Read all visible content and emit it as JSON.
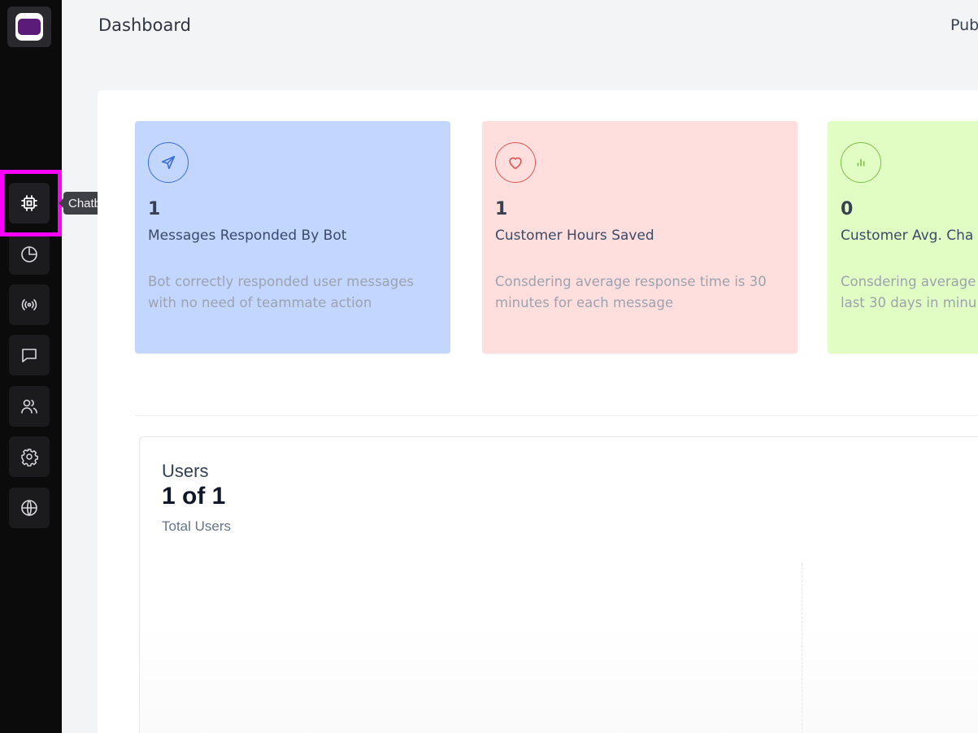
{
  "header": {
    "title": "Dashboard",
    "right_text": "Pub"
  },
  "sidebar": {
    "items": [
      {
        "icon": "chip-icon",
        "active": true
      },
      {
        "icon": "pie-chart-icon"
      },
      {
        "icon": "broadcast-icon"
      },
      {
        "icon": "message-icon"
      },
      {
        "icon": "users-icon"
      },
      {
        "icon": "gear-icon"
      },
      {
        "icon": "globe-icon"
      }
    ],
    "tooltip": "Chatbot AI",
    "highlight_color": "#ff00ff"
  },
  "cards": [
    {
      "icon": "send-icon",
      "value": "1",
      "title": "Messages Responded By Bot",
      "description": "Bot correctly responded user messages with no need of teammate action",
      "color": "#c2d6ff"
    },
    {
      "icon": "heart-icon",
      "value": "1",
      "title": "Customer Hours Saved",
      "description": "Consdering average response time is 30 minutes for each message",
      "color": "#ffdede"
    },
    {
      "icon": "bar-chart-icon",
      "value": "0",
      "title": "Customer Avg. Cha",
      "description_line1": "Consdering average",
      "description_line2": "last 30 days in minu",
      "color": "#e2fdc4"
    }
  ],
  "users": {
    "label": "Users",
    "count": "1 of 1",
    "subtitle": "Total Users"
  }
}
